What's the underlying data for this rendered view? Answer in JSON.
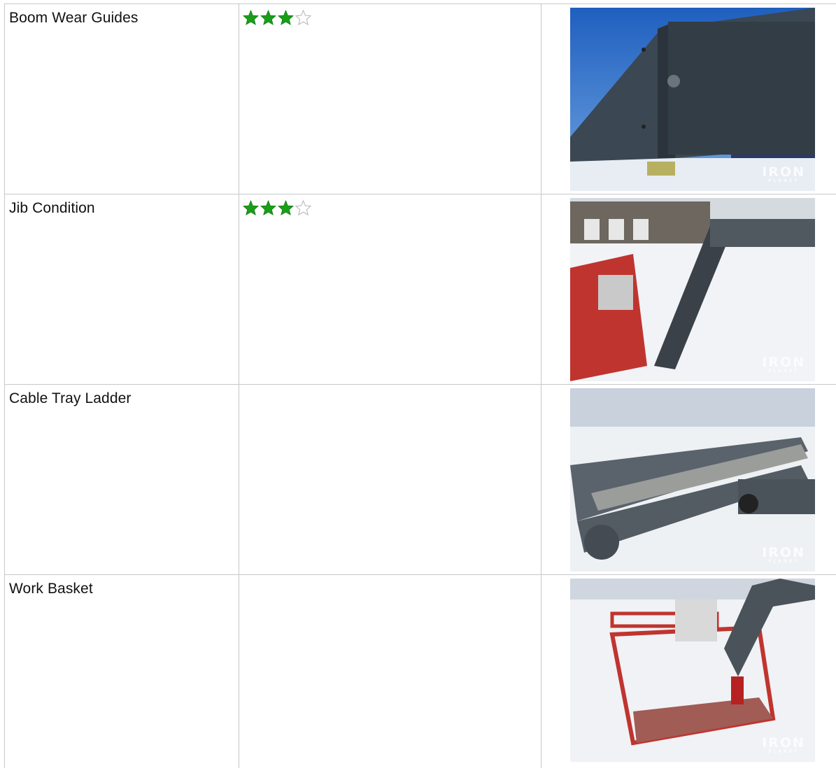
{
  "rows": [
    {
      "label": "Boom Wear Guides",
      "rating": 3,
      "max_rating": 4,
      "photo_icon": "boom-photo"
    },
    {
      "label": "Jib Condition",
      "rating": 3,
      "max_rating": 4,
      "photo_icon": "jib-photo"
    },
    {
      "label": "Cable Tray Ladder",
      "rating": null,
      "max_rating": 4,
      "photo_icon": "cable-tray-photo"
    },
    {
      "label": "Work Basket",
      "rating": null,
      "max_rating": 4,
      "photo_icon": "work-basket-photo"
    }
  ],
  "watermark": {
    "line1": "IRON",
    "line2": "PLANET"
  },
  "colors": {
    "star_filled": "#1a9e1a",
    "star_empty": "#bdbdbd",
    "border": "#c8c8c8"
  }
}
